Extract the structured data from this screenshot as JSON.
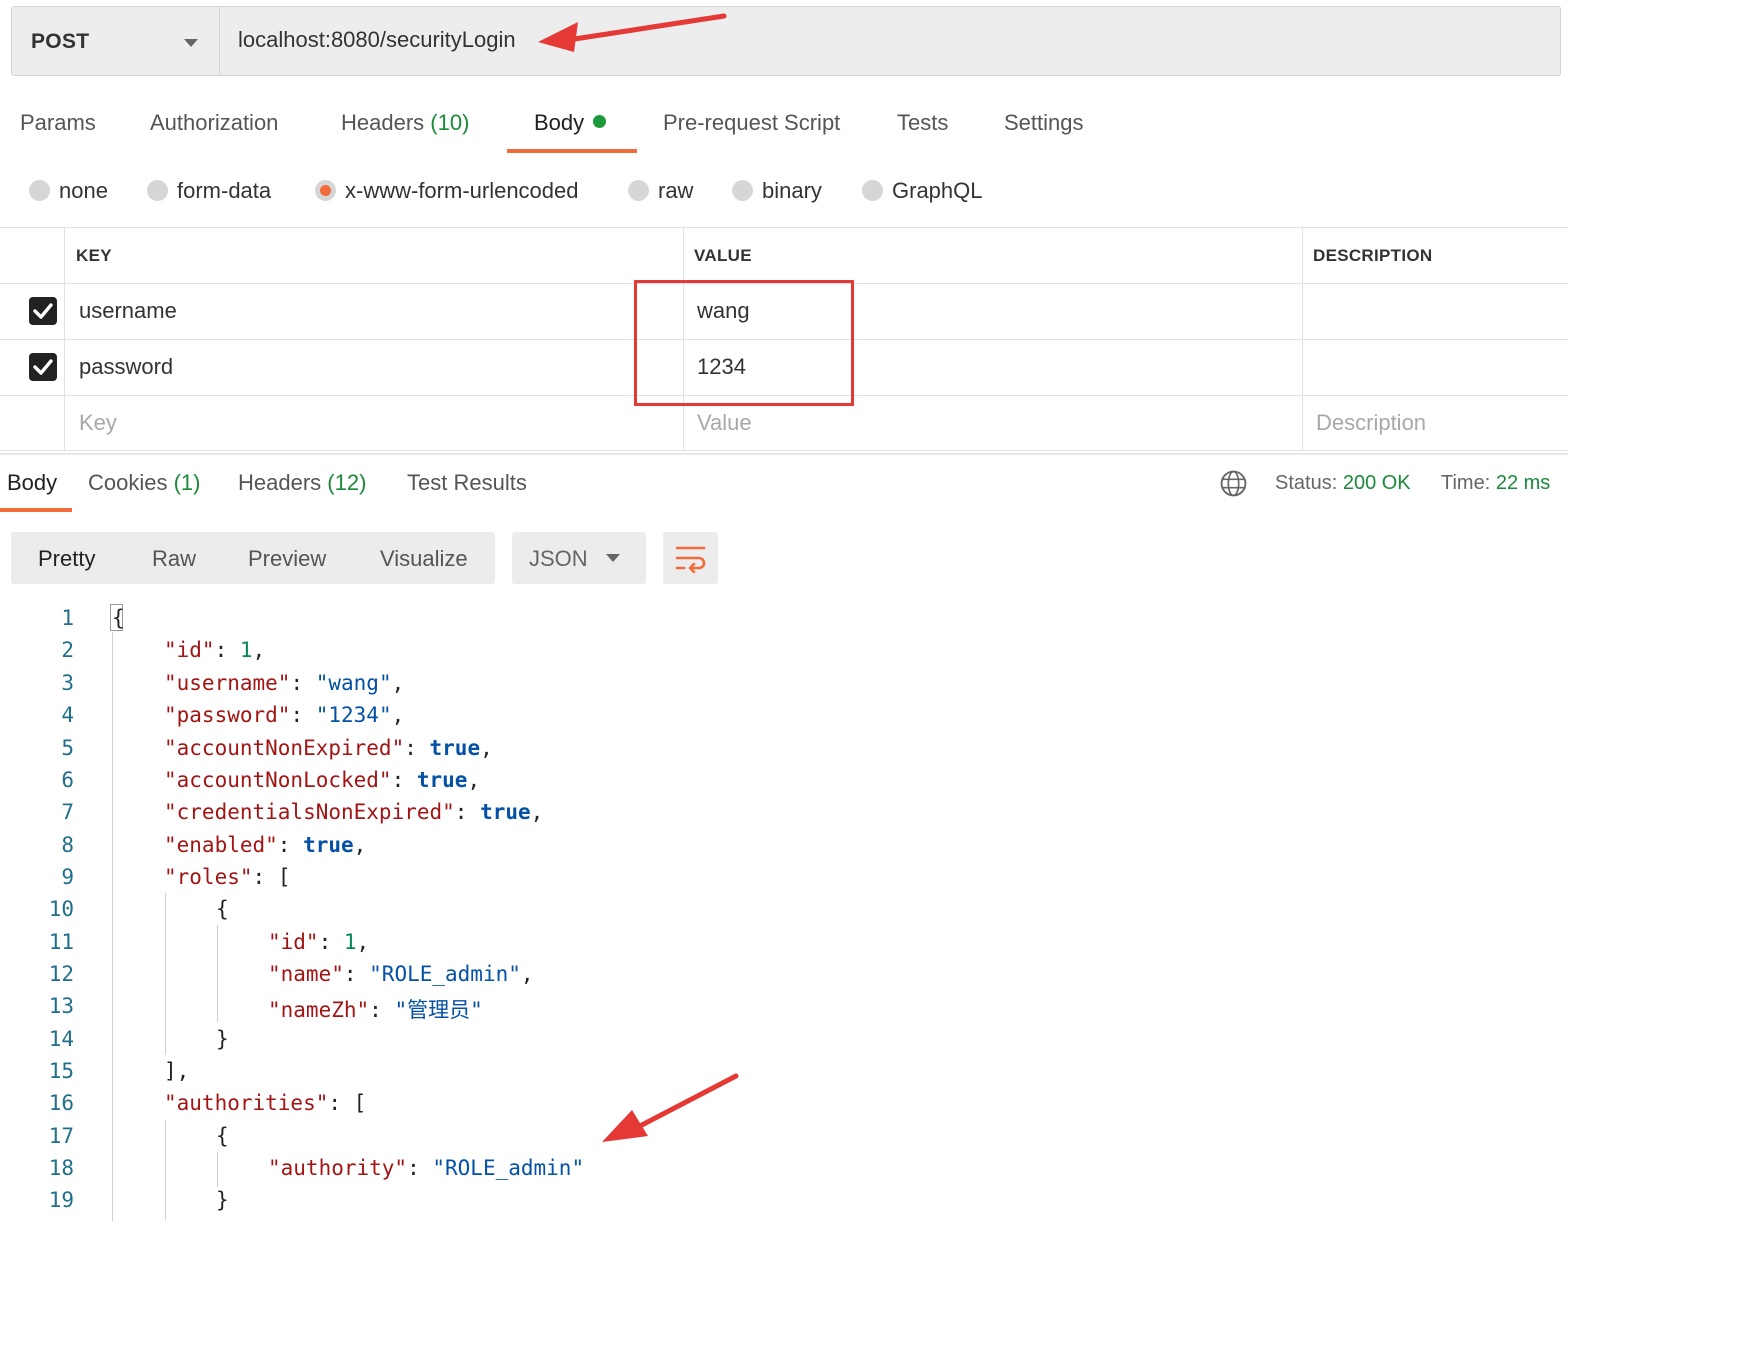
{
  "request": {
    "method": "POST",
    "url": "localhost:8080/securityLogin"
  },
  "request_tabs": [
    {
      "label": "Params"
    },
    {
      "label": "Authorization"
    },
    {
      "label": "Headers",
      "count": "(10)"
    },
    {
      "label": "Body",
      "active": true
    },
    {
      "label": "Pre-request Script"
    },
    {
      "label": "Tests"
    },
    {
      "label": "Settings"
    }
  ],
  "body_types": [
    {
      "label": "none"
    },
    {
      "label": "form-data"
    },
    {
      "label": "x-www-form-urlencoded",
      "selected": true
    },
    {
      "label": "raw"
    },
    {
      "label": "binary"
    },
    {
      "label": "GraphQL"
    }
  ],
  "params_table": {
    "headers": [
      "KEY",
      "VALUE",
      "DESCRIPTION"
    ],
    "rows": [
      {
        "checked": true,
        "key": "username",
        "value": "wang",
        "description": ""
      },
      {
        "checked": true,
        "key": "password",
        "value": "1234",
        "description": ""
      }
    ],
    "placeholders": {
      "key": "Key",
      "value": "Value",
      "description": "Description"
    }
  },
  "response_tabs": [
    {
      "label": "Body",
      "active": true
    },
    {
      "label": "Cookies",
      "count": "(1)"
    },
    {
      "label": "Headers",
      "count": "(12)"
    },
    {
      "label": "Test Results"
    }
  ],
  "response_status": {
    "status_label": "Status:",
    "status_value": "200 OK",
    "time_label": "Time:",
    "time_value": "22 ms"
  },
  "view_modes": [
    "Pretty",
    "Raw",
    "Preview",
    "Visualize"
  ],
  "format": "JSON",
  "code_lines": [
    "1",
    "2",
    "3",
    "4",
    "5",
    "6",
    "7",
    "8",
    "9",
    "10",
    "11",
    "12",
    "13",
    "14",
    "15",
    "16",
    "17",
    "18",
    "19"
  ],
  "code": {
    "l1": "{",
    "l2k": "\"id\"",
    "l2v": "1",
    "l3k": "\"username\"",
    "l3v": "\"wang\"",
    "l4k": "\"password\"",
    "l4v": "\"1234\"",
    "l5k": "\"accountNonExpired\"",
    "l5v": "true",
    "l6k": "\"accountNonLocked\"",
    "l6v": "true",
    "l7k": "\"credentialsNonExpired\"",
    "l7v": "true",
    "l8k": "\"enabled\"",
    "l8v": "true",
    "l9k": "\"roles\"",
    "l9v": "[",
    "l10": "{",
    "l11k": "\"id\"",
    "l11v": "1",
    "l12k": "\"name\"",
    "l12v": "\"ROLE_admin\"",
    "l13k": "\"nameZh\"",
    "l13v": "\"管理员\"",
    "l14": "}",
    "l15": "],",
    "l16k": "\"authorities\"",
    "l16v": "[",
    "l17": "{",
    "l18k": "\"authority\"",
    "l18v": "\"ROLE_admin\"",
    "l19": "}"
  },
  "colors": {
    "accent": "#f26b3a",
    "success": "#1b8a3b",
    "annotation_red": "#e53935"
  },
  "icons": [
    "dropdown-caret-icon",
    "checkbox-checked-icon",
    "globe-icon",
    "wrap-lines-icon",
    "arrow-annotation-icon"
  ]
}
